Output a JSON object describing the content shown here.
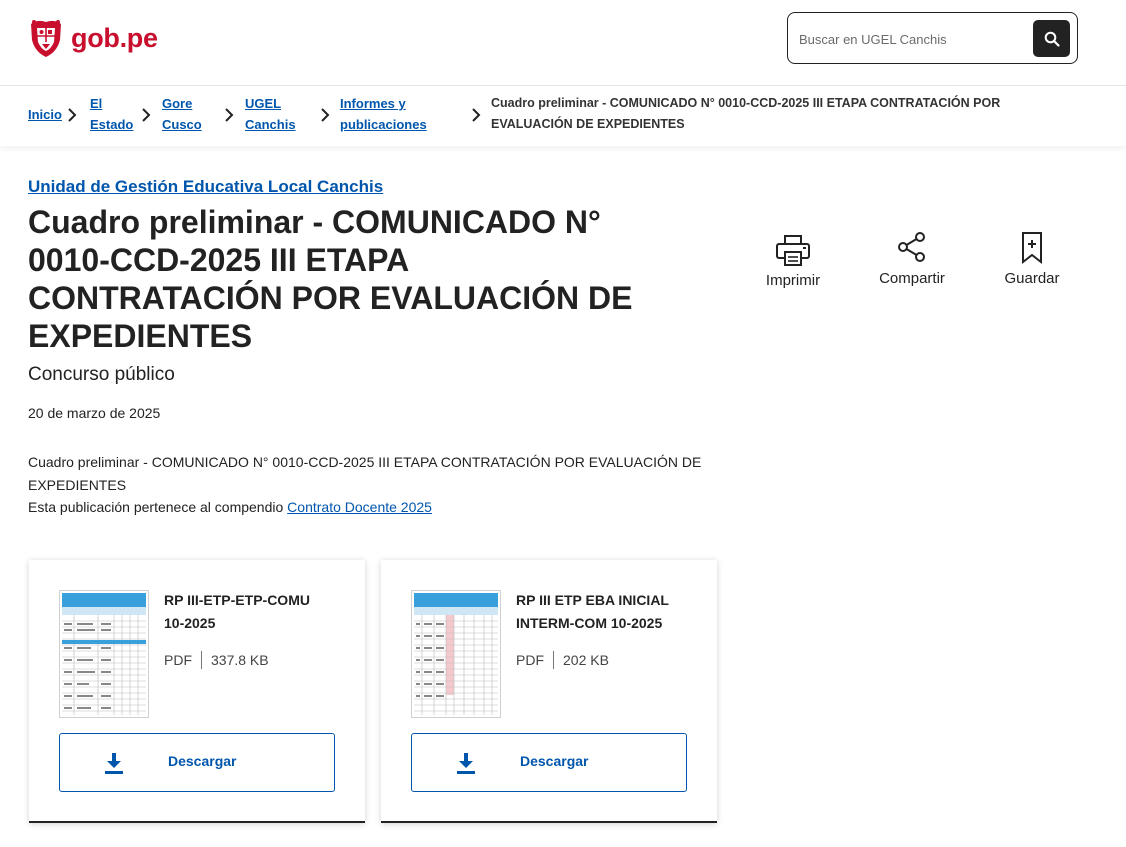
{
  "header": {
    "logo_text": "gob.pe",
    "search_placeholder": "Buscar en UGEL Canchis"
  },
  "breadcrumb": {
    "items": [
      {
        "label_lines": [
          "Inicio"
        ]
      },
      {
        "label_lines": [
          "El",
          "Estado"
        ]
      },
      {
        "label_lines": [
          "Gore",
          "Cusco"
        ]
      },
      {
        "label_lines": [
          "UGEL",
          "Canchis"
        ]
      },
      {
        "label_lines": [
          "Informes y",
          "publicaciones"
        ]
      }
    ],
    "current_lines": [
      "Cuadro preliminar - COMUNICADO N° 0010-CCD-2025 III ETAPA CONTRATACIÓN POR",
      "EVALUACIÓN DE EXPEDIENTES"
    ]
  },
  "main": {
    "agency": "Unidad de Gestión Educativa Local Canchis",
    "title": "Cuadro preliminar - COMUNICADO N° 0010-CCD-2025 III ETAPA CONTRATACIÓN POR EVALUACIÓN DE EXPEDIENTES",
    "subtitle": "Concurso público",
    "date": "20 de marzo de 2025",
    "description": "Cuadro preliminar - COMUNICADO N° 0010-CCD-2025 III ETAPA CONTRATACIÓN POR EVALUACIÓN DE EXPEDIENTES",
    "compendium_prefix": "Esta publicación pertenece al compendio",
    "compendium_link": "Contrato Docente 2025"
  },
  "actions": [
    {
      "label": "Imprimir",
      "icon": "printer-icon"
    },
    {
      "label": "Compartir",
      "icon": "share-icon"
    },
    {
      "label": "Guardar",
      "icon": "bookmark-icon"
    }
  ],
  "documents": [
    {
      "title": "RP III-ETP-ETP-COMU 10-2025",
      "format": "PDF",
      "size": "337.8 KB",
      "button": "Descargar"
    },
    {
      "title": "RP III ETP EBA INICIAL INTERM-COM 10-2025",
      "format": "PDF",
      "size": "202 KB",
      "button": "Descargar"
    }
  ],
  "colors": {
    "brand_red": "#c8102e",
    "link_blue": "#0056ac",
    "text_dark": "#222222"
  }
}
